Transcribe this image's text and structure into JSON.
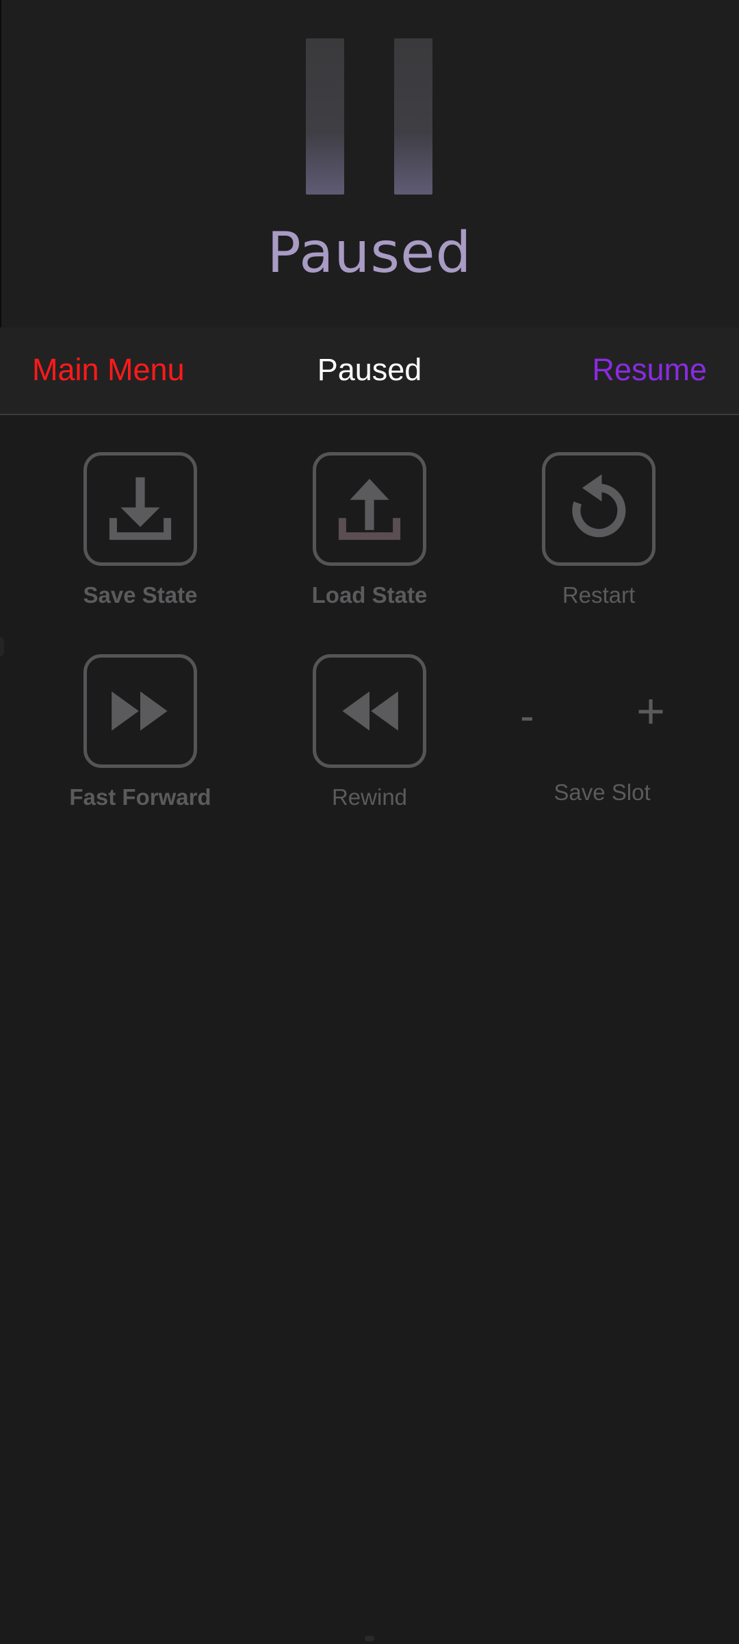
{
  "game_screen": {
    "paused_text": "Paused"
  },
  "navbar": {
    "main_menu_label": "Main Menu",
    "title": "Paused",
    "resume_label": "Resume",
    "colors": {
      "main_menu": "#ff1a1a",
      "title": "#ffffff",
      "resume": "#8a2be2"
    }
  },
  "actions": [
    {
      "label": "Save State",
      "icon": "save-state-icon"
    },
    {
      "label": "Load State",
      "icon": "load-state-icon"
    },
    {
      "label": "Restart",
      "icon": "restart-icon"
    },
    {
      "label": "Fast Forward",
      "icon": "fast-forward-icon"
    },
    {
      "label": "Rewind",
      "icon": "rewind-icon"
    }
  ],
  "save_slot": {
    "label": "Save Slot",
    "decrement": "-",
    "increment": "+"
  }
}
